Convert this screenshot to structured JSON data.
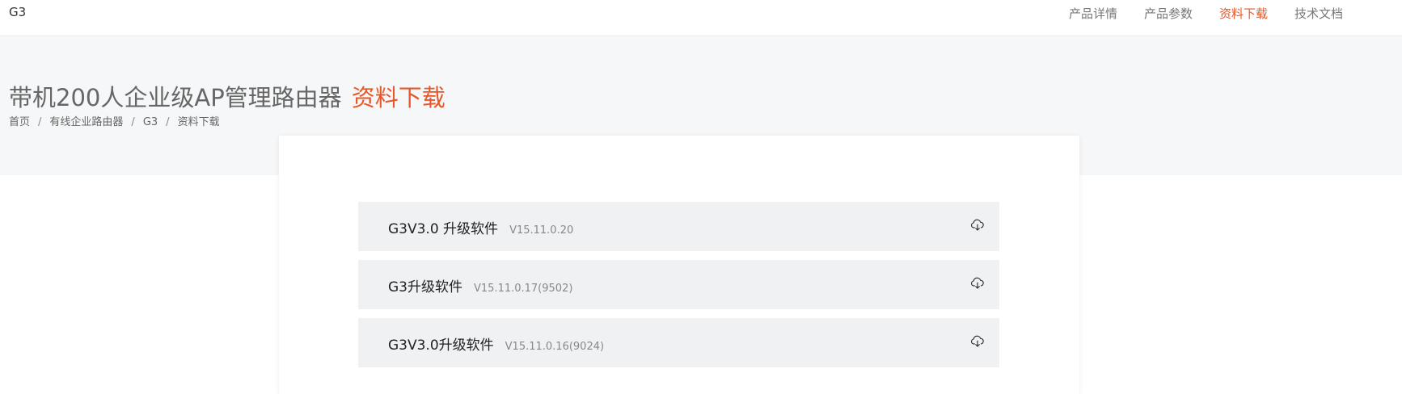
{
  "header": {
    "brand": "G3",
    "nav": [
      "产品详情",
      "产品参数",
      "资料下载",
      "技术文档"
    ]
  },
  "hero": {
    "title": "带机200人企业级AP管理路由器",
    "title_accent": "资料下载",
    "breadcrumb": [
      "首页",
      "有线企业路由器",
      "G3",
      "资料下载"
    ]
  },
  "downloads": [
    {
      "name": "G3V3.0 升级软件",
      "version": "V15.11.0.20",
      "icon": "cloud-download-icon"
    },
    {
      "name": "G3升级软件",
      "version": "V15.11.0.17(9502)",
      "icon": "cloud-download-icon"
    },
    {
      "name": "G3V3.0升级软件",
      "version": "V15.11.0.16(9024)",
      "icon": "cloud-download-icon"
    }
  ],
  "colors": {
    "accent": "#e8572a",
    "hero_bg": "#f6f7f8",
    "item_bg": "#f0f1f2"
  }
}
